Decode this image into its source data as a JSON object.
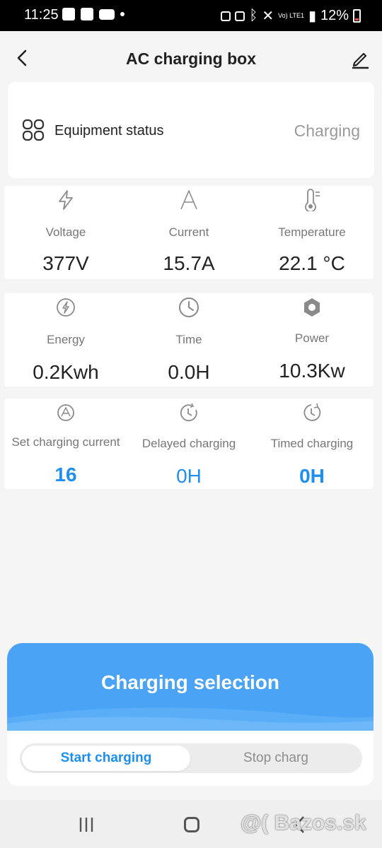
{
  "status_bar": {
    "time": "11:25",
    "battery": "12%",
    "network": "Vo) LTE1"
  },
  "header": {
    "title": "AC charging box",
    "back_icon": "chevron-left-icon",
    "edit_icon": "pencil-icon"
  },
  "equipment": {
    "label": "Equipment status",
    "value": "Charging",
    "icon": "grid-four-icon"
  },
  "metrics_row1": [
    {
      "icon": "lightning-icon",
      "label": "Voltage",
      "value": "377V"
    },
    {
      "icon": "ampere-icon",
      "label": "Current",
      "value": "15.7A"
    },
    {
      "icon": "thermometer-icon",
      "label": "Temperature",
      "value": "22.1 °C"
    }
  ],
  "metrics_row2": [
    {
      "icon": "energy-icon",
      "label": "Energy",
      "value": "0.2Kwh"
    },
    {
      "icon": "clock-icon",
      "label": "Time",
      "value": "0.0H"
    },
    {
      "icon": "hex-nut-icon",
      "label": "Power",
      "value": "10.3Kw"
    }
  ],
  "settings_row": [
    {
      "icon": "current-setting-icon",
      "label": "Set charging current",
      "value": "16"
    },
    {
      "icon": "delay-clock-icon",
      "label": "Delayed charging",
      "value": "0H"
    },
    {
      "icon": "timer-clock-icon",
      "label": "Timed charging",
      "value": "0H"
    }
  ],
  "selection": {
    "title": "Charging selection",
    "tabs": [
      "Start charging",
      "Stop charg"
    ],
    "active_tab": "Start charging"
  },
  "watermark": "@( Bazos.sk",
  "colors": {
    "accent": "#1d8ff0",
    "panel": "#4aa3f5",
    "background": "#f5f5f5"
  }
}
